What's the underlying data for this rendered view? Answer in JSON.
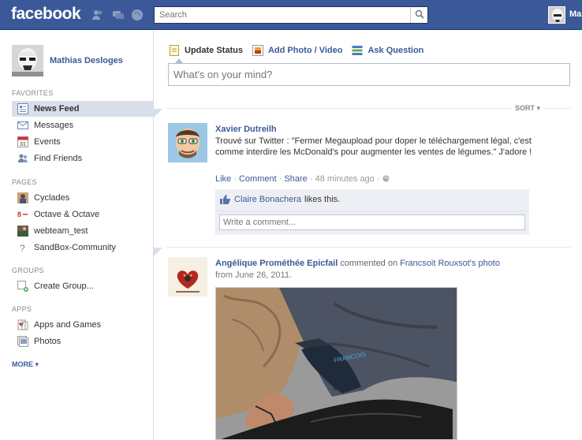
{
  "topbar": {
    "logo": "facebook",
    "search_placeholder": "Search",
    "user_short": "Ma"
  },
  "sidebar": {
    "profile_name": "Mathias Desloges",
    "favorites_heading": "FAVORITES",
    "favorites": [
      {
        "label": "News Feed",
        "icon": "news-feed-icon"
      },
      {
        "label": "Messages",
        "icon": "messages-icon"
      },
      {
        "label": "Events",
        "icon": "events-icon"
      },
      {
        "label": "Find Friends",
        "icon": "find-friends-icon"
      }
    ],
    "events_day": "31",
    "pages_heading": "PAGES",
    "pages": [
      {
        "label": "Cyclades"
      },
      {
        "label": "Octave & Octave"
      },
      {
        "label": "webteam_test"
      },
      {
        "label": "SandBox-Community"
      }
    ],
    "groups_heading": "GROUPS",
    "groups": [
      {
        "label": "Create Group..."
      }
    ],
    "apps_heading": "APPS",
    "apps": [
      {
        "label": "Apps and Games"
      },
      {
        "label": "Photos"
      }
    ],
    "more_label": "MORE"
  },
  "composer": {
    "tabs": [
      {
        "label": "Update Status",
        "icon": "status-icon"
      },
      {
        "label": "Add Photo / Video",
        "icon": "photo-icon"
      },
      {
        "label": "Ask Question",
        "icon": "question-icon"
      }
    ],
    "placeholder": "What's on your mind?"
  },
  "sort_label": "SORT",
  "stories": [
    {
      "actor": "Xavier Dutreilh",
      "message": "Trouvé sur Twitter : \"Fermer Megaupload pour doper le téléchargement légal, c'est comme interdire les McDonald's pour augmenter les ventes de légumes.\" J'adore !",
      "actions": {
        "like": "Like",
        "comment": "Comment",
        "share": "Share",
        "time": "48 minutes ago"
      },
      "likes": {
        "name": "Claire Bonachera",
        "suffix": "likes this."
      },
      "comment_placeholder": "Write a comment..."
    },
    {
      "actor": "Angélique Prométhée Epicfail",
      "verb": "commented on",
      "object": "Francsoit Rouxsot's photo",
      "date_line": "from June 26, 2011."
    }
  ],
  "colors": {
    "brand_blue": "#3b5998",
    "active_nav": "#d8dfea",
    "ufi_bg": "#edeff4"
  }
}
